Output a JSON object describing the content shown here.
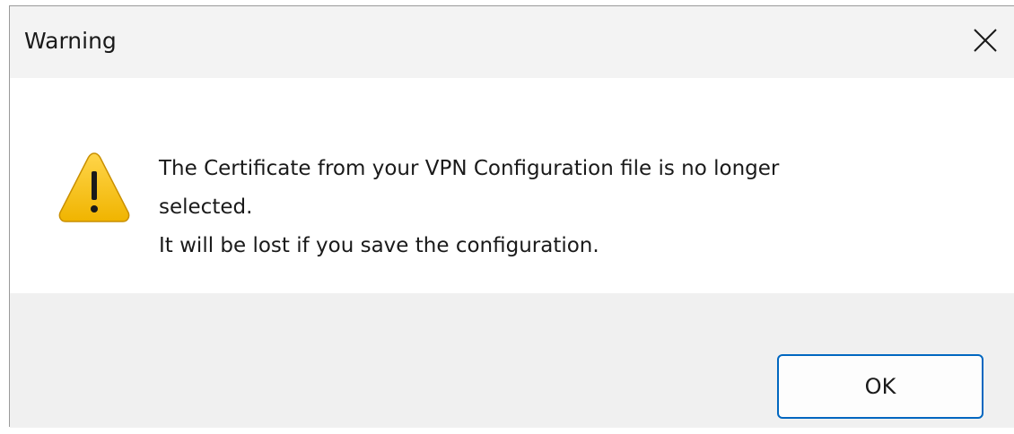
{
  "dialog": {
    "title": "Warning",
    "close_icon": "close-icon",
    "warning_icon": "warning-triangle-icon",
    "message": {
      "line1": "The Certificate from your VPN Configuration file is no longer",
      "line2": "selected.",
      "line3": "It will be lost if you save the configuration."
    },
    "ok_label": "OK",
    "accent_color": "#0067c0",
    "warning_color": "#f4c430"
  }
}
